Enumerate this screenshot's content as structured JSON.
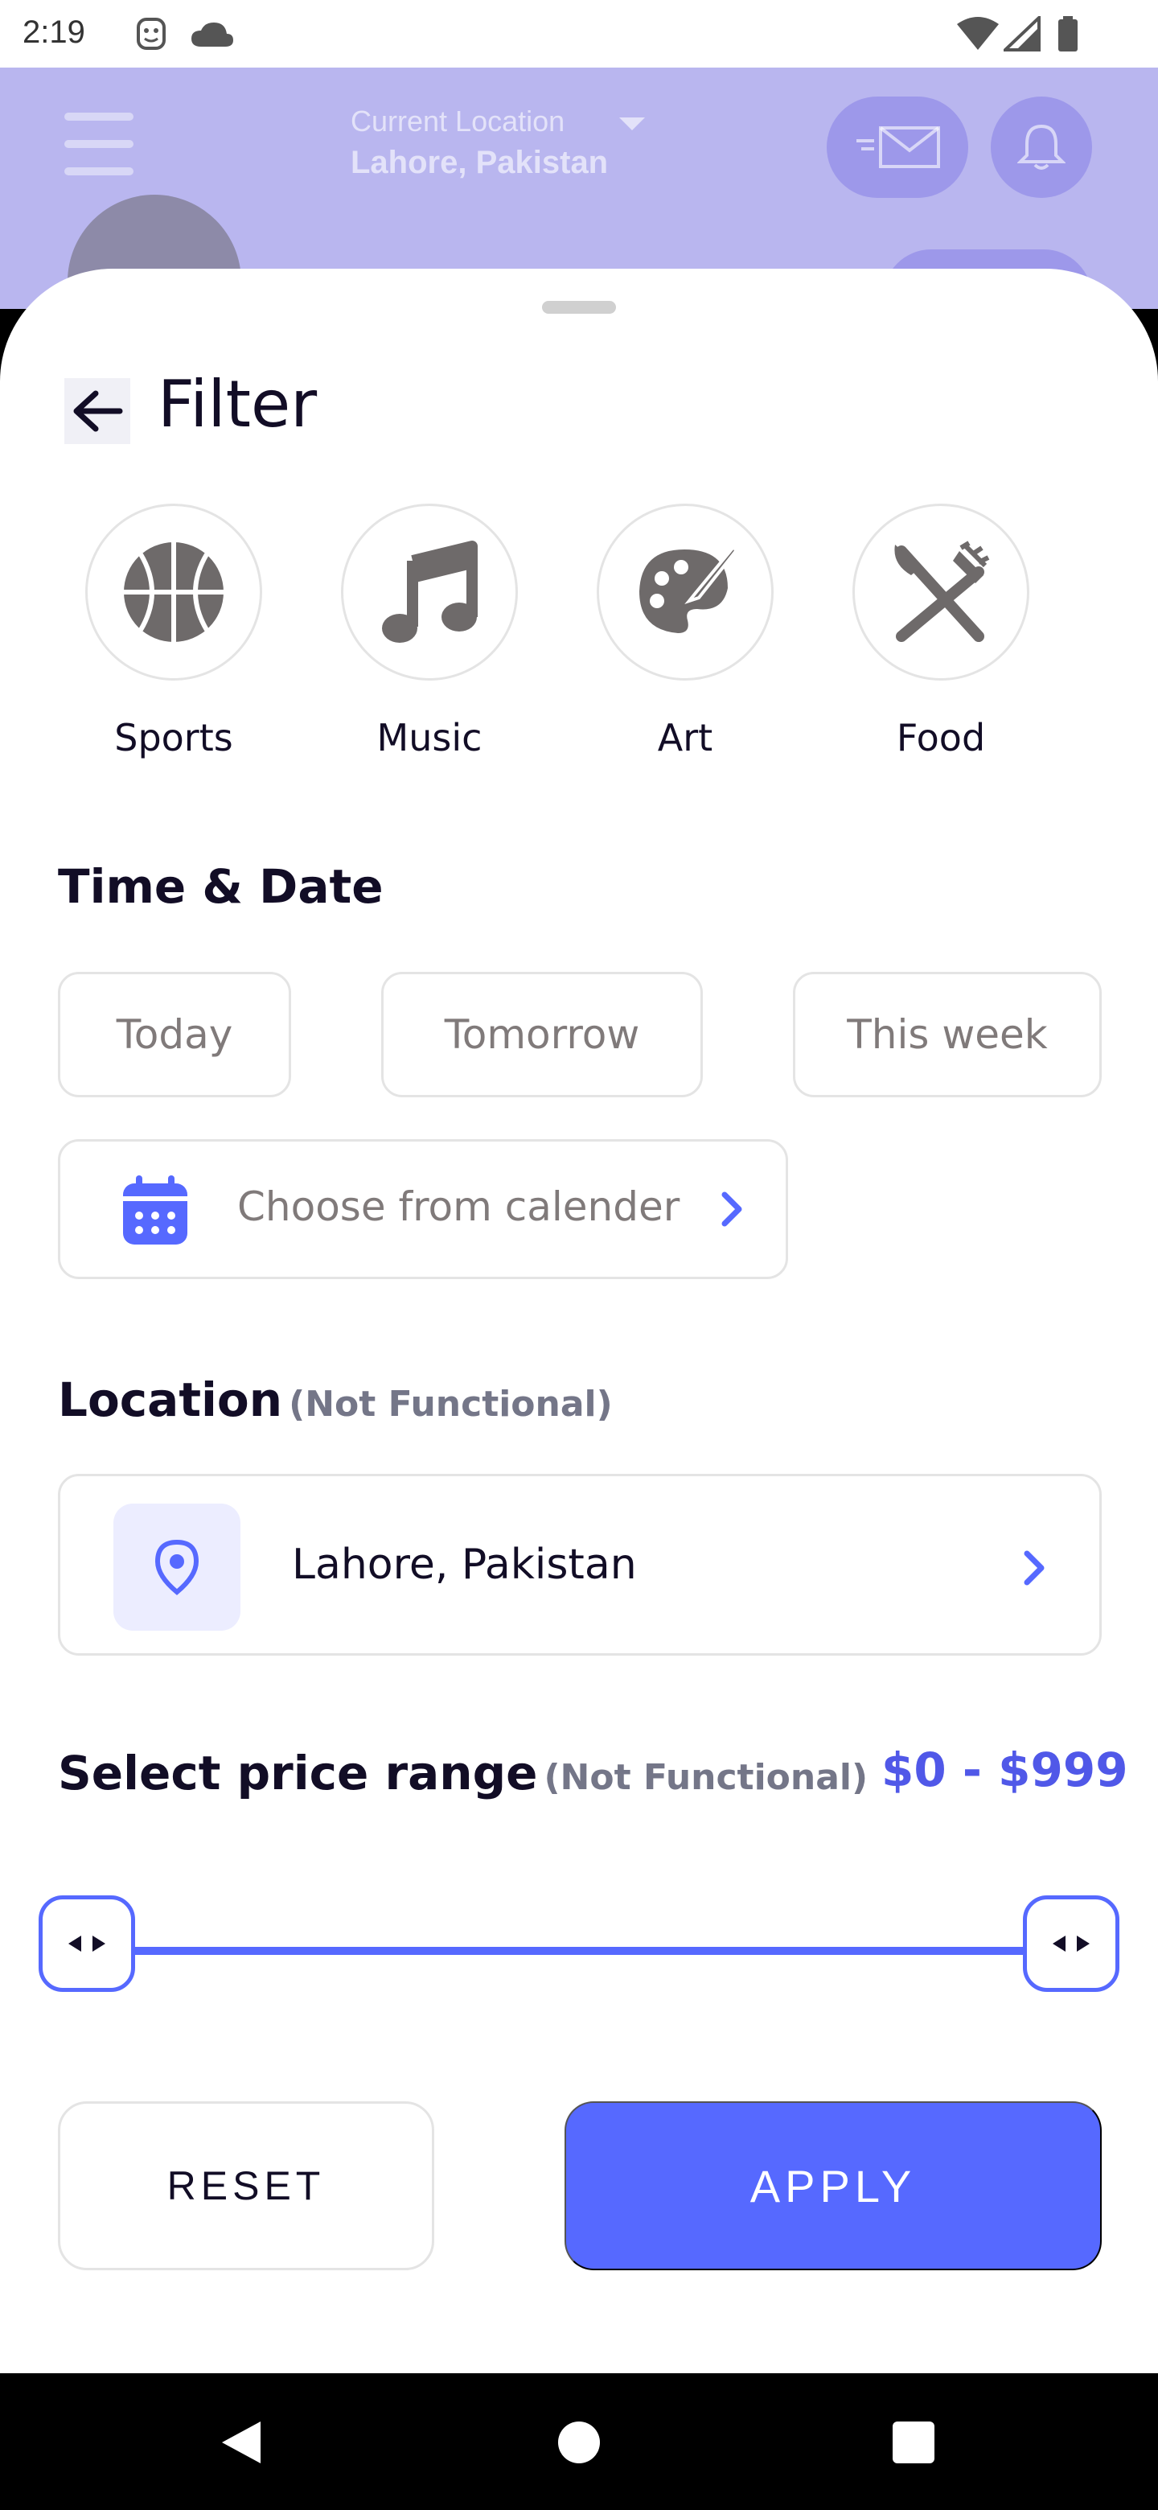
{
  "status_bar": {
    "time": "2:19"
  },
  "background": {
    "location_label": "Current Location",
    "location_value": "Lahore, Pakistan"
  },
  "sheet": {
    "title": "Filter",
    "categories": [
      {
        "label": "Sports",
        "icon": "basketball-icon"
      },
      {
        "label": "Music",
        "icon": "music-note-icon"
      },
      {
        "label": "Art",
        "icon": "palette-icon"
      },
      {
        "label": "Food",
        "icon": "utensils-icon"
      }
    ],
    "time_date": {
      "title": "Time & Date",
      "chips": [
        "Today",
        "Tomorrow",
        "This week"
      ],
      "calendar_label": "Choose from calender"
    },
    "location": {
      "title": "Location",
      "subtitle": "(Not Functional)",
      "value": "Lahore, Pakistan"
    },
    "price": {
      "title": "Select price range",
      "subtitle": "(Not Functional)",
      "value": "$0 - $999",
      "range_min_fraction": 0,
      "range_max_fraction": 1
    },
    "buttons": {
      "reset": "RESET",
      "apply": "APPLY"
    }
  },
  "colors": {
    "accent": "#5669FF",
    "text": "#120D26",
    "muted": "#807A7A"
  }
}
